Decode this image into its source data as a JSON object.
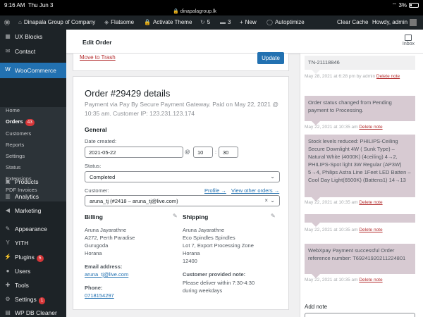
{
  "status_bar": {
    "time": "9:16 AM",
    "date": "Thu Jun 3",
    "url": "dinapalagroup.lk",
    "battery": "3%"
  },
  "admin_bar": {
    "site_name": "Dinapala Group of Company",
    "theme": "Flatsome",
    "activate": "Activate Theme",
    "updates": "5",
    "comments": "3",
    "new": "New",
    "autoptimize": "Autoptimize",
    "clear_cache": "Clear Cache",
    "howdy": "Howdy, admin"
  },
  "sidebar": {
    "ux_blocks": "UX Blocks",
    "contact": "Contact",
    "woocommerce": "WooCommerce",
    "sub": {
      "home": "Home",
      "orders": "Orders",
      "orders_count": "43",
      "customers": "Customers",
      "reports": "Reports",
      "settings": "Settings",
      "status": "Status",
      "extensions": "Extensions",
      "pdf": "PDF Invoices"
    },
    "products": "Products",
    "analytics": "Analytics",
    "marketing": "Marketing",
    "appearance": "Appearance",
    "yith": "YITH",
    "plugins": "Plugins",
    "plugins_count": "5",
    "users": "Users",
    "tools": "Tools",
    "settings": "Settings",
    "settings_count": "1",
    "wp_db": "WP DB Cleaner"
  },
  "header": {
    "title": "Edit Order",
    "inbox": "Inbox"
  },
  "actions": {
    "trash": "Move to Trash",
    "update": "Update"
  },
  "order": {
    "title": "Order #29429 details",
    "subtitle": "Payment via Pay By Secure Payment Gateway. Paid on May 22, 2021 @ 10:35 am. Customer IP: 123.231.123.174",
    "general": "General",
    "date_label": "Date created:",
    "date": "2021-05-22",
    "hour": "10",
    "minute": "30",
    "status_label": "Status:",
    "status": "Completed",
    "customer_label": "Customer:",
    "profile_link": "Profile →",
    "view_orders_link": "View other orders →",
    "customer": "aruna_tj (#2418 – aruna_tj@live.com)"
  },
  "billing": {
    "title": "Billing",
    "lines": [
      "Aruna Jayarathne",
      "A272, Perth Paradise",
      "Gurugoda",
      "Horana"
    ],
    "email_label": "Email address:",
    "email": "aruna_tj@live.com",
    "phone_label": "Phone:",
    "phone": "0718154297"
  },
  "shipping": {
    "title": "Shipping",
    "lines": [
      "Aruna Jayarathne",
      "Eco Spindles Spindles",
      "Lot 7, Export Processing Zone",
      "Horana",
      "12400"
    ],
    "note_label": "Customer provided note:",
    "note_lines": [
      "Please deliver within 7:30-4:30",
      "during weekdays"
    ]
  },
  "notes": {
    "n1": {
      "text": "TN-21118846",
      "meta": "May 28, 2021 at 6:28 pm by admin",
      "del": "Delete note"
    },
    "n2": {
      "text": "Order status changed from Pending payment to Processing.",
      "meta": "May 22, 2021 at 10:35 am",
      "del": "Delete note"
    },
    "n3": {
      "text": "Stock levels reduced: PHILIPS-Ceiling Secure Downlight 4W ( Sunk Type) – Natural White (4000K) (4ceiling) 4→2, PHILIPS-Spot light 3W Regular (AP3W) 5→4, Philips Astra Line 1Feet LED Batten – Cool Day Light(6500K) (Battens1) 14→13",
      "meta": "May 22, 2021 at 10:35 am",
      "del": "Delete note"
    },
    "n4": {
      "meta": "May 22, 2021 at 10:35 am",
      "del": "Delete note"
    },
    "n5": {
      "text": "WebXpay Payment successful Order reference number: T69241920211224801",
      "meta": "May 22, 2021 at 10:35 am",
      "del": "Delete note"
    },
    "add_note": "Add note"
  }
}
